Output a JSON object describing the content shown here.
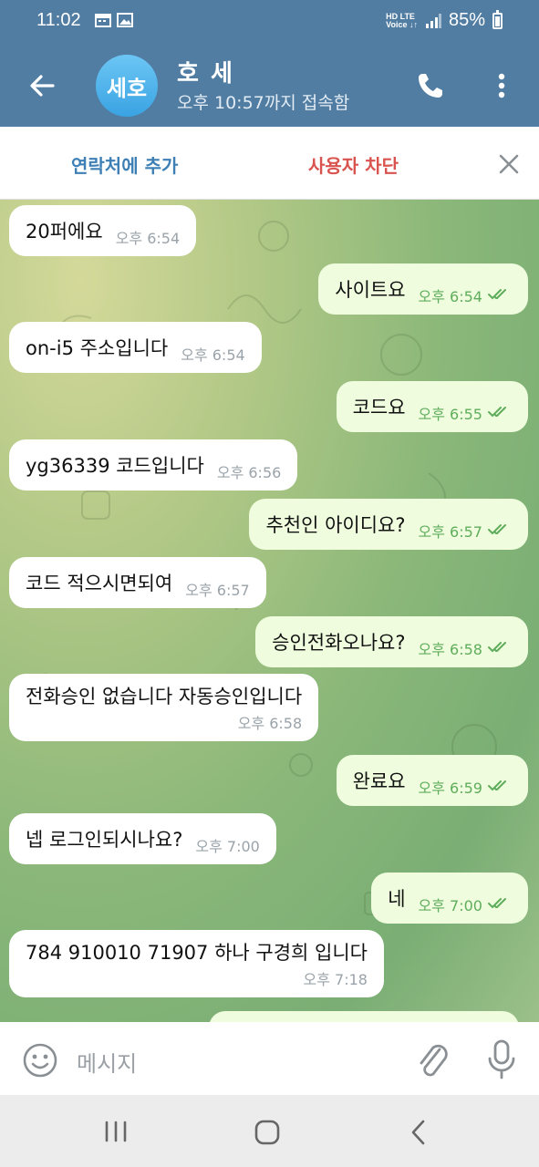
{
  "status_bar": {
    "time": "11:02",
    "net_top": "HD LTE",
    "net_bottom": "Voice ↓↑",
    "battery": "85%"
  },
  "header": {
    "avatar_text": "세호",
    "title": "호 세",
    "subtitle": "오후 10:57까지 접속함",
    "avatar_color": "#3aa3e3",
    "bar_color": "#517da2"
  },
  "action_bar": {
    "add_contact": "연락처에 추가",
    "block_user": "사용자 차단"
  },
  "messages": [
    {
      "dir": "in",
      "text": "20퍼에요",
      "time": "오후 6:54"
    },
    {
      "dir": "out",
      "text": "사이트요",
      "time": "오후 6:54",
      "read": true
    },
    {
      "dir": "in",
      "text": "on-i5 주소입니다",
      "time": "오후 6:54"
    },
    {
      "dir": "out",
      "text": "코드요",
      "time": "오후 6:55",
      "read": true
    },
    {
      "dir": "in",
      "text": "yg36339 코드입니다",
      "time": "오후 6:56"
    },
    {
      "dir": "out",
      "text": "추천인 아이디요?",
      "time": "오후 6:57",
      "read": true
    },
    {
      "dir": "in",
      "text": "코드 적으시면되여",
      "time": "오후 6:57"
    },
    {
      "dir": "out",
      "text": "승인전화오나요?",
      "time": "오후 6:58",
      "read": true
    },
    {
      "dir": "in",
      "text": "전화승인 없습니다 자동승인입니다",
      "time": "오후 6:58"
    },
    {
      "dir": "out",
      "text": "완료요",
      "time": "오후 6:59",
      "read": true
    },
    {
      "dir": "in",
      "text": "넵 로그인되시나요?",
      "time": "오후 7:00"
    },
    {
      "dir": "out",
      "text": "네",
      "time": "오후 7:00",
      "read": true
    },
    {
      "dir": "in",
      "text": "784 910010 71907 하나 구경희 입니다",
      "time": "오후 7:18"
    }
  ],
  "input": {
    "placeholder": "메시지"
  },
  "colors": {
    "incoming_bubble": "#ffffff",
    "outgoing_bubble": "#effdde",
    "outgoing_time": "#5fad5c",
    "block_red": "#d9534f",
    "link_blue": "#3e80b5"
  }
}
